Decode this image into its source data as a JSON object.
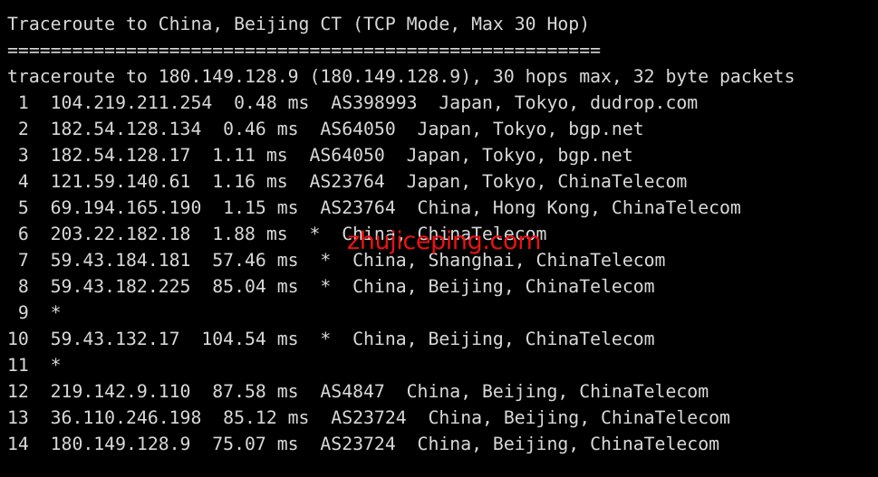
{
  "terminal": {
    "background_color": "#000000",
    "foreground_color": "#d8d8d8",
    "watermark_color": "#ee1111",
    "header": {
      "title_line": "Traceroute to China, Beijing CT (TCP Mode, Max 30 Hop)",
      "separator_line": "=======================================================",
      "command_line": "traceroute to 180.149.128.9 (180.149.128.9), 30 hops max, 32 byte packets"
    },
    "watermark_text": "zhujiceping.com",
    "target": {
      "destination": "China, Beijing CT",
      "mode": "TCP Mode",
      "max_hops": "30",
      "ip": "180.149.128.9",
      "packet_size": "32 byte packets"
    },
    "columns": [
      "hop",
      "ip",
      "rtt",
      "asn",
      "location"
    ],
    "hops": [
      {
        "hop": "1",
        "ip": "104.219.211.254",
        "rtt": "0.48 ms",
        "loss_marker": "",
        "asn": "AS398993",
        "location": "Japan, Tokyo, dudrop.com",
        "raw": " 1  104.219.211.254  0.48 ms  AS398993  Japan, Tokyo, dudrop.com"
      },
      {
        "hop": "2",
        "ip": "182.54.128.134",
        "rtt": "0.46 ms",
        "loss_marker": "",
        "asn": "AS64050",
        "location": "Japan, Tokyo, bgp.net",
        "raw": " 2  182.54.128.134  0.46 ms  AS64050  Japan, Tokyo, bgp.net"
      },
      {
        "hop": "3",
        "ip": "182.54.128.17",
        "rtt": "1.11 ms",
        "loss_marker": "",
        "asn": "AS64050",
        "location": "Japan, Tokyo, bgp.net",
        "raw": " 3  182.54.128.17  1.11 ms  AS64050  Japan, Tokyo, bgp.net"
      },
      {
        "hop": "4",
        "ip": "121.59.140.61",
        "rtt": "1.16 ms",
        "loss_marker": "",
        "asn": "AS23764",
        "location": "Japan, Tokyo, ChinaTelecom",
        "raw": " 4  121.59.140.61  1.16 ms  AS23764  Japan, Tokyo, ChinaTelecom"
      },
      {
        "hop": "5",
        "ip": "69.194.165.190",
        "rtt": "1.15 ms",
        "loss_marker": "",
        "asn": "AS23764",
        "location": "China, Hong Kong, ChinaTelecom",
        "raw": " 5  69.194.165.190  1.15 ms  AS23764  China, Hong Kong, ChinaTelecom"
      },
      {
        "hop": "6",
        "ip": "203.22.182.18",
        "rtt": "1.88 ms",
        "loss_marker": "*",
        "asn": "",
        "location": "China, ChinaTelecom",
        "raw": " 6  203.22.182.18  1.88 ms  *  China, ChinaTelecom"
      },
      {
        "hop": "7",
        "ip": "59.43.184.181",
        "rtt": "57.46 ms",
        "loss_marker": "*",
        "asn": "",
        "location": "China, Shanghai, ChinaTelecom",
        "raw": " 7  59.43.184.181  57.46 ms  *  China, Shanghai, ChinaTelecom"
      },
      {
        "hop": "8",
        "ip": "59.43.182.225",
        "rtt": "85.04 ms",
        "loss_marker": "*",
        "asn": "",
        "location": "China, Beijing, ChinaTelecom",
        "raw": " 8  59.43.182.225  85.04 ms  *  China, Beijing, ChinaTelecom"
      },
      {
        "hop": "9",
        "ip": "*",
        "rtt": "",
        "loss_marker": "",
        "asn": "",
        "location": "",
        "raw": " 9  *"
      },
      {
        "hop": "10",
        "ip": "59.43.132.17",
        "rtt": "104.54 ms",
        "loss_marker": "*",
        "asn": "",
        "location": "China, Beijing, ChinaTelecom",
        "raw": "10  59.43.132.17  104.54 ms  *  China, Beijing, ChinaTelecom"
      },
      {
        "hop": "11",
        "ip": "*",
        "rtt": "",
        "loss_marker": "",
        "asn": "",
        "location": "",
        "raw": "11  *"
      },
      {
        "hop": "12",
        "ip": "219.142.9.110",
        "rtt": "87.58 ms",
        "loss_marker": "",
        "asn": "AS4847",
        "location": "China, Beijing, ChinaTelecom",
        "raw": "12  219.142.9.110  87.58 ms  AS4847  China, Beijing, ChinaTelecom"
      },
      {
        "hop": "13",
        "ip": "36.110.246.198",
        "rtt": "85.12 ms",
        "loss_marker": "",
        "asn": "AS23724",
        "location": "China, Beijing, ChinaTelecom",
        "raw": "13  36.110.246.198  85.12 ms  AS23724  China, Beijing, ChinaTelecom"
      },
      {
        "hop": "14",
        "ip": "180.149.128.9",
        "rtt": "75.07 ms",
        "loss_marker": "",
        "asn": "AS23724",
        "location": "China, Beijing, ChinaTelecom",
        "raw": "14  180.149.128.9  75.07 ms  AS23724  China, Beijing, ChinaTelecom"
      }
    ]
  }
}
